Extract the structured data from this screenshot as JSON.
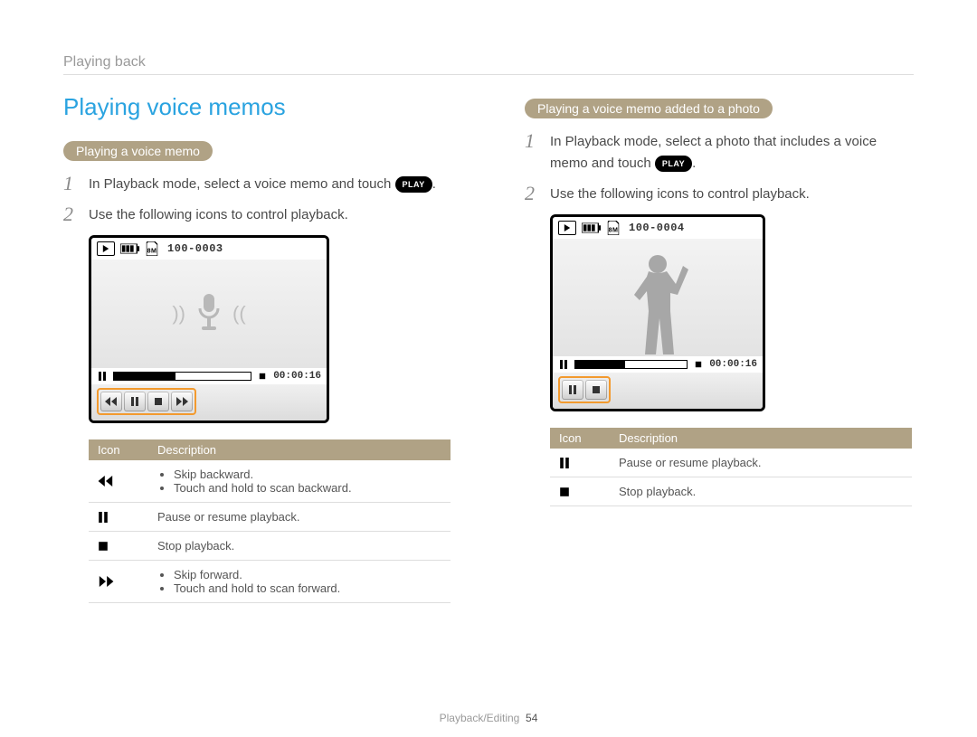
{
  "breadcrumb": "Playing back",
  "title": "Playing voice memos",
  "play_label": "PLAY",
  "left": {
    "subheading": "Playing a voice memo",
    "steps": [
      {
        "num": "1",
        "text_a": "In Playback mode, select a voice memo and touch ",
        "text_b": "."
      },
      {
        "num": "2",
        "text_a": "Use the following icons to control playback.",
        "text_b": ""
      }
    ],
    "screen": {
      "filecount": "100-0003",
      "time": "00:00:16"
    },
    "table": {
      "head_icon": "Icon",
      "head_desc": "Description",
      "rows": [
        {
          "icon": "rewind",
          "bullets": [
            "Skip backward.",
            "Touch and hold to scan backward."
          ]
        },
        {
          "icon": "pause",
          "text": "Pause or resume playback."
        },
        {
          "icon": "stop",
          "text": "Stop playback."
        },
        {
          "icon": "ffwd",
          "bullets": [
            "Skip forward.",
            "Touch and hold to scan forward."
          ]
        }
      ]
    }
  },
  "right": {
    "subheading": "Playing a voice memo added to a photo",
    "steps": [
      {
        "num": "1",
        "text_a": "In Playback mode, select a photo that includes a voice memo and touch ",
        "text_b": "."
      },
      {
        "num": "2",
        "text_a": "Use the following icons to control playback.",
        "text_b": ""
      }
    ],
    "screen": {
      "filecount": "100-0004",
      "time": "00:00:16"
    },
    "table": {
      "head_icon": "Icon",
      "head_desc": "Description",
      "rows": [
        {
          "icon": "pause",
          "text": "Pause or resume playback."
        },
        {
          "icon": "stop",
          "text": "Stop playback."
        }
      ]
    }
  },
  "footer": {
    "section": "Playback/Editing",
    "page": "54"
  }
}
